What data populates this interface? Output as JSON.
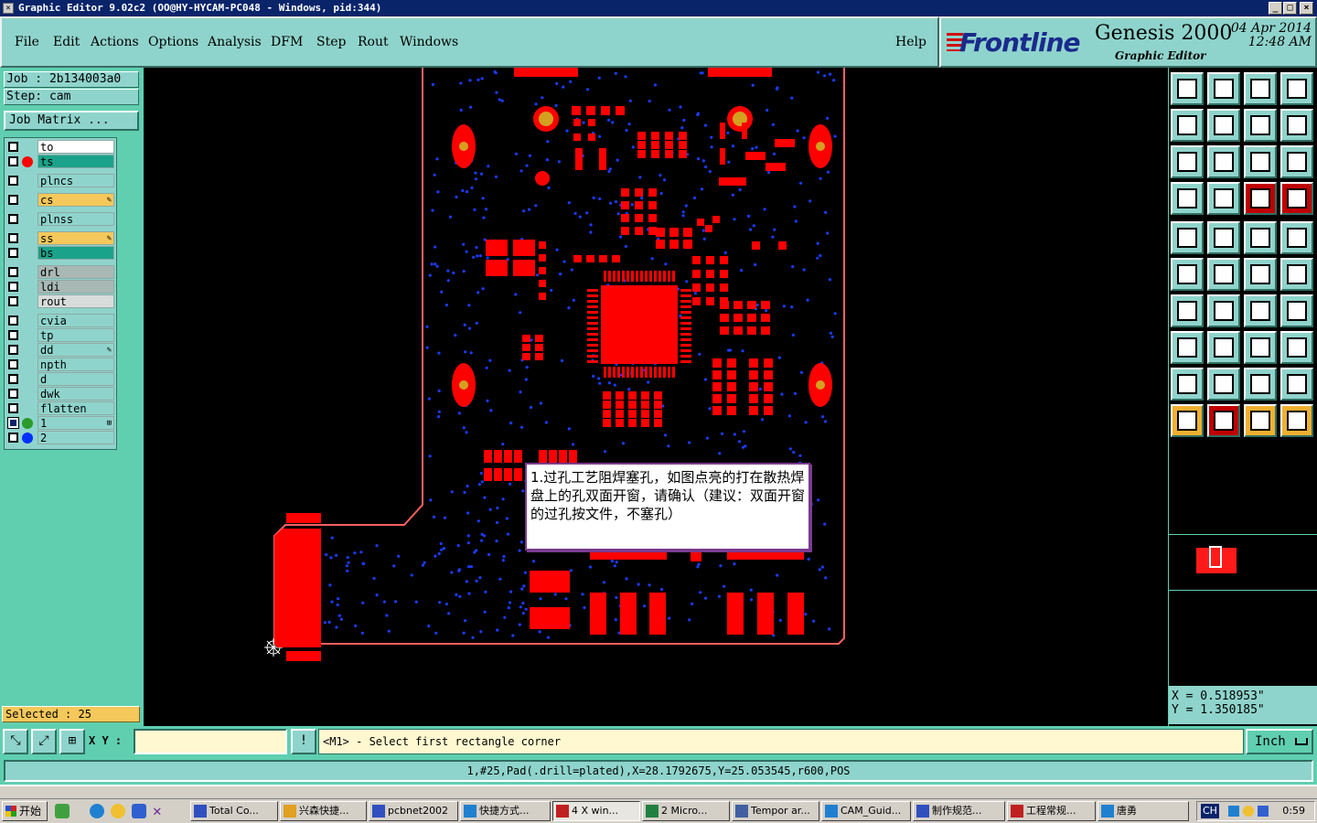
{
  "window": {
    "title": "Graphic Editor 9.02c2  (OO@HY-HYCAM-PC048 - Windows, pid:344)",
    "minimize": "_",
    "maximize": "□",
    "close": "×"
  },
  "menu": {
    "items": [
      "File",
      "Edit",
      "Actions",
      "Options",
      "Analysis",
      "DFM",
      "Step",
      "Rout",
      "Windows"
    ],
    "help": "Help"
  },
  "brand": {
    "logo": "Frontline",
    "product": "Genesis 2000",
    "subtitle": "Graphic Editor",
    "date": "04 Apr 2014",
    "time": "12:48 AM"
  },
  "job": {
    "job_line": "Job : 2b134003a0",
    "step_line": "Step: cam",
    "matrix_button": "Job Matrix ..."
  },
  "layers": [
    {
      "name": "to",
      "color": "#ffffff",
      "dot": "",
      "flag": ""
    },
    {
      "name": "ts",
      "color": "#1aa38a",
      "dot": "#ff0000",
      "flag": ""
    },
    {
      "name": "plncs",
      "color": "#8fd4cc",
      "dot": "",
      "flag": ""
    },
    {
      "name": "cs",
      "color": "#f4c85a",
      "dot": "",
      "flag": "✎"
    },
    {
      "name": "plnss",
      "color": "#8fd4cc",
      "dot": "",
      "flag": ""
    },
    {
      "name": "ss",
      "color": "#f4c85a",
      "dot": "",
      "flag": "✎"
    },
    {
      "name": "bs",
      "color": "#1aa38a",
      "dot": "",
      "flag": ""
    },
    {
      "name": "drl",
      "color": "#a8b8b4",
      "dot": "",
      "flag": ""
    },
    {
      "name": "ldi",
      "color": "#a8b8b4",
      "dot": "",
      "flag": ""
    },
    {
      "name": "rout",
      "color": "#d8dcda",
      "dot": "",
      "flag": ""
    },
    {
      "name": "cvia",
      "color": "#8fd4cc",
      "dot": "",
      "flag": ""
    },
    {
      "name": "tp",
      "color": "#8fd4cc",
      "dot": "",
      "flag": ""
    },
    {
      "name": "dd",
      "color": "#8fd4cc",
      "dot": "",
      "flag": "✎"
    },
    {
      "name": "npth",
      "color": "#8fd4cc",
      "dot": "",
      "flag": ""
    },
    {
      "name": "d",
      "color": "#8fd4cc",
      "dot": "",
      "flag": ""
    },
    {
      "name": "dwk",
      "color": "#8fd4cc",
      "dot": "",
      "flag": ""
    },
    {
      "name": "flatten",
      "color": "#8fd4cc",
      "dot": "",
      "flag": ""
    },
    {
      "name": "1",
      "color": "#8fd4cc",
      "dot": "#2a9a2a",
      "flag": "⊞"
    },
    {
      "name": "2",
      "color": "#8fd4cc",
      "dot": "#0030ff",
      "flag": ""
    }
  ],
  "selected": "Selected : 25",
  "popup": {
    "text": "1.过孔工艺阻焊塞孔，如图点亮的打在散热焊盘上的孔双面开窗，请确认（建议：双面开窗的过孔按文件，不塞孔）"
  },
  "coords": {
    "x": "X  =  0.518953\"",
    "y": "Y  =  1.350185\""
  },
  "command": {
    "xy_label": "X Y :",
    "xy_value": "",
    "bang": "!",
    "prompt": "<M1> - Select first rectangle corner",
    "units": "Inch"
  },
  "info": "1,#25,Pad(.drill=plated),X=28.1792675,Y=25.053545,r600,POS",
  "taskbar": {
    "start": "开始",
    "tasks": [
      {
        "label": "Total Co...",
        "color": "#3050c0"
      },
      {
        "label": "兴森快捷...",
        "color": "#e0a020"
      },
      {
        "label": "pcbnet2002",
        "color": "#3050c0"
      },
      {
        "label": "快捷方式...",
        "color": "#2080d0"
      },
      {
        "label": "4 X win...",
        "color": "#c02020"
      },
      {
        "label": "2 Micro...",
        "color": "#208040"
      },
      {
        "label": "Tempor ar...",
        "color": "#4060a0"
      },
      {
        "label": "CAM_Guid...",
        "color": "#2080d0"
      },
      {
        "label": "制作规范...",
        "color": "#3050c0"
      },
      {
        "label": "工程常规...",
        "color": "#c02020"
      },
      {
        "label": "唐勇",
        "color": "#2080d0"
      }
    ],
    "clock": "0:59",
    "tray_lang": "CH"
  }
}
